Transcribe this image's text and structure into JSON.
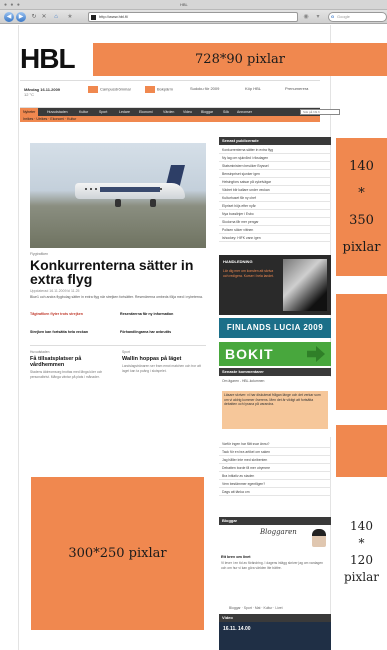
{
  "browser": {
    "window_title": "HBL",
    "url": "http://www.hbl.fi/",
    "search_placeholder": "Google",
    "back_label": "◀",
    "forward_label": "▶",
    "reload_label": "↻",
    "stop_label": "✕",
    "home_label": "⌂"
  },
  "site": {
    "logo": "HBL",
    "date": "Måndag 16.11.2009",
    "date2": "12 °C",
    "promos": [
      "Campusdrömmar",
      "Bokpärm",
      "Sudoku för 2009",
      "Köp HBL",
      "Prenumerera"
    ],
    "nav": [
      "Nyheter",
      "Huvudstaden",
      "Kultur",
      "Sport",
      "Ledare",
      "Ekonomi",
      "Värden",
      "Video",
      "Bloggar",
      "Sök",
      "Annonser"
    ],
    "subnav": "Inrikes · Utrikes · Ekonomi · Kultur",
    "search_placeholder": "Sök på hbl.fi"
  },
  "ads": {
    "top": "728*90 pixlar",
    "right1_line1": "140",
    "right1_line2": "*",
    "right1_line3": "350",
    "right1_line4": "pixlar",
    "mid": "300*250 pixlar",
    "right_label_line1": "140",
    "right_label_line2": "*",
    "right_label_line3": "120",
    "right_label_line4": "pixlar"
  },
  "main": {
    "kicker": "Flygtrafiken",
    "headline": "Konkurrenterna sätter in extra flyg",
    "byline": "Uppdaterad 16.11.2009 kl 11.25",
    "lede": "Blue1 och andra flygbolag sätter in extra flyg när strejken fortsätter. Resenärerna ombeds följa med i nyheterna.",
    "related": [
      {
        "title": "Tågtrafiken flyter trots strejken",
        "tag": "nyhet"
      },
      {
        "title": "Resenärerna får ny information",
        "tag": "uppdatering"
      },
      {
        "title": "Strejken kan fortsätta hela veckan",
        "tag": "analys"
      },
      {
        "title": "Förhandlingarna har avbrutits",
        "tag": "nyhet"
      }
    ],
    "articles": [
      {
        "kicker": "Huvudstaden",
        "headline": "Få tillsatsplatser på vårdhemmen",
        "body": "Stadens äldreomsorg brottas med långa köer och personalbrist. Många väntar på plats i månader."
      },
      {
        "kicker": "Sport",
        "headline": "Wallin hoppas på läget",
        "body": "Landslagstränaren ser fram emot matchen och tror att laget kan ta poäng i slutspelet."
      }
    ]
  },
  "sidebar": {
    "most_read_title": "Senast publicerade",
    "most_read": [
      "Konkurrenterna sätter in extra flyg",
      "Ny lag om sjukvård i riksdagen",
      "Statsministern besöker Bryssel",
      "Bensinpriset sjunker igen",
      "Helsingfors satsar på cykelvägar",
      "Vädret blir kallare under veckan",
      "Kulturhuset får ny chef",
      "Elpriset höjs efter nyår",
      "Nya busslinjer i Esbo",
      "Skolorna får mer pengar",
      "Polisen söker vittnen",
      "Ishockey: HIFK vann igen"
    ],
    "promo_title": "HANDLEDNING",
    "promo_sub": "Lär dig mer om konsten att skriva och redigera. Kurser i hela landet.",
    "lucia": "FINLANDS LUCIA 2009",
    "bokit": "BOKIT",
    "readers_title": "Senaste kommentarer",
    "readers_intro": "Om ägaren - HBL-kolumnen",
    "readers_highlight": "Läsare skriver: vi har diskuterat frågan länge och det verkar som om vi aldrig kommer överens. Men det är viktigt att fortsätta debatten och lyssna på varandra.",
    "comments": [
      "Varför ingen har fått svar ännu?",
      "Tack för en bra artikel om saken",
      "Jag håller inte med skribenten",
      "Debatten borde få mer utrymme",
      "Bra initiativ av staden",
      "Vem bestämmer egentligen?",
      "Dags att tänka om"
    ],
    "blog_title": "Bloggar",
    "blog_signature": "Bloggaren",
    "blog_post_title": "Ett brev om livet",
    "blog_post_body": "Vi lever i en tid av förändring. I dagens inlägg skriver jag om vardagen och om hur vi kan göra världen lite bättre.",
    "blog_links": "Bloggar · Sport · Mat · Kultur · Livet",
    "video_title": "Video",
    "video_time": "16.11. 14.00"
  }
}
